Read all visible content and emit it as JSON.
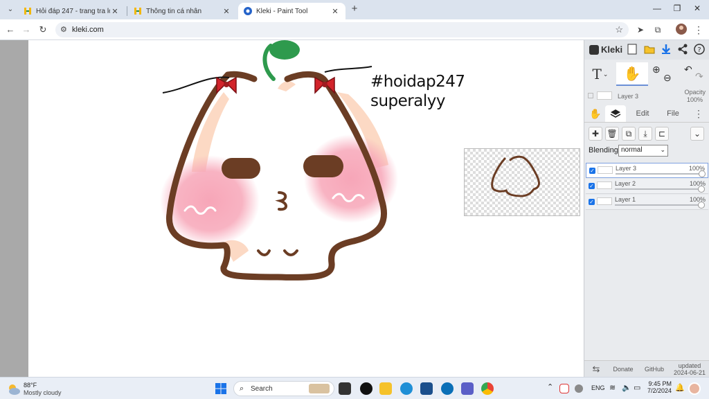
{
  "browser": {
    "tabs": [
      {
        "title": "Hỏi đáp 247 - trang tra loi"
      },
      {
        "title": "Thông tin cá nhân"
      },
      {
        "title": "Kleki - Paint Tool"
      }
    ],
    "url": "kleki.com"
  },
  "canvas": {
    "hashtag_line1": "#hoidap247",
    "hashtag_line2": "superalyy"
  },
  "panel": {
    "logo": "Kleki",
    "layer_info_name": "Layer 3",
    "opacity_label": "Opacity",
    "opacity_value": "100%",
    "tabs": {
      "edit": "Edit",
      "file": "File"
    },
    "blending_label": "Blending",
    "blending_value": "normal",
    "layers": [
      {
        "name": "Layer 3",
        "opacity": "100%",
        "opacity_value": 1.0,
        "selected": true
      },
      {
        "name": "Layer 2",
        "opacity": "100%",
        "opacity_value": 1.0,
        "selected": false
      },
      {
        "name": "Layer 1",
        "opacity": "100%",
        "opacity_value": 1.0,
        "selected": false
      }
    ],
    "footer": {
      "donate": "Donate",
      "github": "GitHub",
      "updated_label": "updated",
      "updated_date": "2024-06-21"
    }
  },
  "taskbar": {
    "weather_temp": "88°F",
    "weather_desc": "Mostly cloudy",
    "search_placeholder": "Search",
    "lang": "ENG",
    "time": "9:45 PM",
    "date": "7/2/2024"
  },
  "colors": {
    "brown_outline": "#6b3d24",
    "blush": "#f7a6b8",
    "leaf": "#2e9a4d",
    "bow": "#d2232a",
    "skin": "#fcd9c4"
  }
}
